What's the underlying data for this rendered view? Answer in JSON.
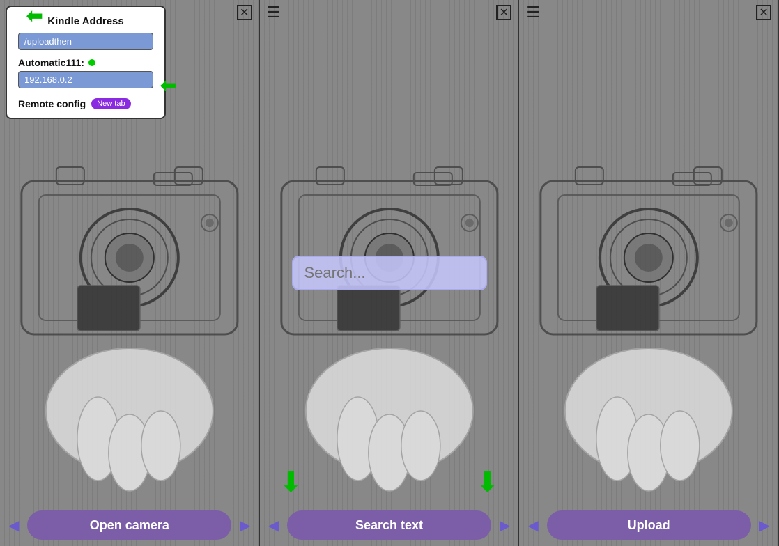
{
  "panels": [
    {
      "id": "panel-1",
      "topbar": {
        "menu_icon": "☰",
        "close_icon": "✕"
      },
      "kindle_popup": {
        "title": "Kindle Address",
        "upload_path_value": "/uploadthen",
        "upload_path_placeholder": "/uploadthen",
        "auto_label": "Automatic111:",
        "ip_value": "192.168.0.2",
        "ip_placeholder": "192.168.0.2",
        "remote_label": "Remote config",
        "new_tab_badge": "New tab"
      },
      "bottom_btn_label": "Open camera",
      "left_arrow": "◀",
      "right_arrow": "▶"
    },
    {
      "id": "panel-2",
      "topbar": {
        "menu_icon": "☰",
        "close_icon": "✕"
      },
      "search_placeholder": "Search...",
      "bottom_btn_label": "Search text",
      "left_arrow": "◀",
      "right_arrow": "▶"
    },
    {
      "id": "panel-3",
      "topbar": {
        "menu_icon": "☰",
        "close_icon": "✕"
      },
      "bottom_btn_label": "Upload",
      "left_arrow": "◀",
      "right_arrow": "▶"
    }
  ],
  "arrows": {
    "back_arrow": "⬅",
    "down_arrow": "⬇",
    "auto_arrow": "⬅"
  }
}
